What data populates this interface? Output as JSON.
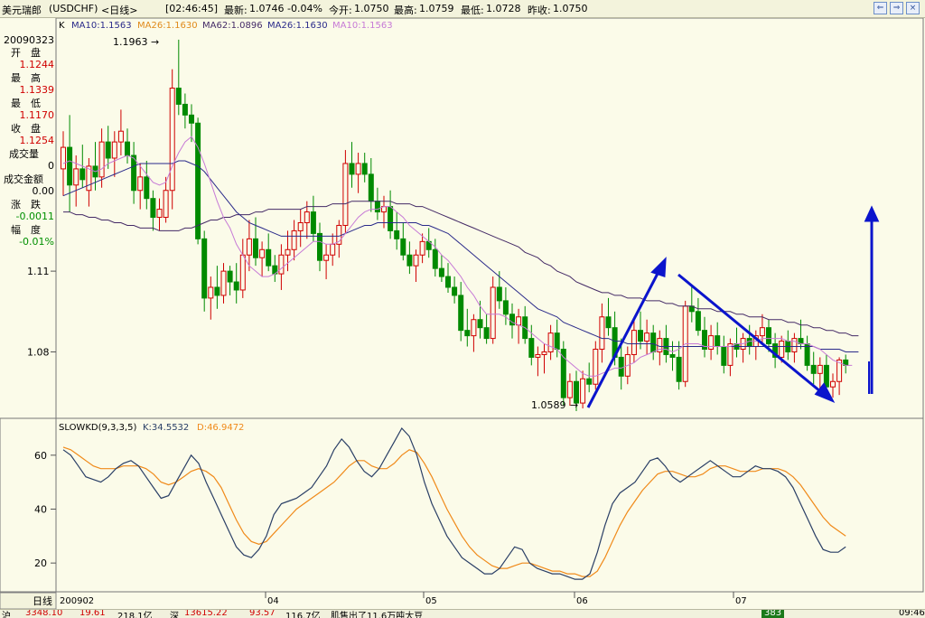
{
  "window": {
    "name": "美元瑞郎",
    "code": "(USDCHF)",
    "period": "<日线>",
    "time": "[02:46:45]",
    "latest_label": "最新:",
    "latest": "1.0746",
    "change": "-0.04%",
    "open_label": "今开:",
    "open": "1.0750",
    "high_label": "最高:",
    "high": "1.0759",
    "low_label": "最低:",
    "low": "1.0728",
    "prev_label": "昨收:",
    "prev": "1.0750"
  },
  "legend": {
    "k": "K",
    "ma": [
      "MA10:1.1563",
      "MA26:1.1630",
      "MA62:1.0896",
      "MA26:1.1630",
      "MA10:1.1563"
    ]
  },
  "info_panel": {
    "date": "20090323",
    "rows": [
      {
        "label": "开　盘",
        "value": "1.1244"
      },
      {
        "label": "最　高",
        "value": "1.1339"
      },
      {
        "label": "最　低",
        "value": "1.1170"
      },
      {
        "label": "收　盘",
        "value": "1.1254"
      },
      {
        "label": "成交量",
        "value": "0"
      },
      {
        "label": "成交金额",
        "value": "0.00"
      },
      {
        "label": "涨　跌",
        "value": "-0.0011"
      },
      {
        "label": "幅　度",
        "value": "-0.01%"
      }
    ]
  },
  "annotations": {
    "high_mark": "1.1963",
    "low_mark": "1.0589"
  },
  "kd_legend": {
    "name": "SLOWKD(9,3,3,5)",
    "k": "K:34.5532",
    "d": "D:46.9472"
  },
  "period_button": "日线",
  "colors": {
    "up": "#d00000",
    "down": "#008a00",
    "ma10": "#c77ad6",
    "ma26": "#2a2a8a",
    "ma62": "#442a66",
    "k_line": "#2a3f66",
    "d_line": "#f08a1a",
    "arrow": "#0b14cc",
    "bg": "#fbfbe9"
  },
  "status": {
    "sh_label": "沪",
    "sh_index": "3348.10",
    "sh_change": "19.61",
    "sh_amount": "218.1亿",
    "sz_label": "深",
    "sz_index": "13615.22",
    "sz_change": "93.57",
    "sz_amount": "116.7亿",
    "news": "肌售出了11.6万吨大豆",
    "badge": "383",
    "clock": "09:46"
  },
  "chart_data": {
    "type": "candlestick",
    "price_axis": {
      "ticks": [
        1.11,
        1.08
      ],
      "range": [
        1.057,
        1.2
      ]
    },
    "kd_axis": {
      "ticks": [
        60,
        40,
        20
      ],
      "range": [
        10,
        72
      ]
    },
    "time_labels": [
      "200902",
      "04",
      "05",
      "06",
      "07"
    ],
    "candles": [
      [
        1.148,
        1.162,
        1.138,
        1.156
      ],
      [
        1.156,
        1.168,
        1.132,
        1.142
      ],
      [
        1.142,
        1.153,
        1.134,
        1.148
      ],
      [
        1.148,
        1.157,
        1.141,
        1.144
      ],
      [
        1.14,
        1.152,
        1.134,
        1.149
      ],
      [
        1.149,
        1.158,
        1.14,
        1.145
      ],
      [
        1.145,
        1.163,
        1.141,
        1.158
      ],
      [
        1.158,
        1.164,
        1.148,
        1.152
      ],
      [
        1.152,
        1.162,
        1.145,
        1.158
      ],
      [
        1.158,
        1.17,
        1.153,
        1.162
      ],
      [
        1.158,
        1.163,
        1.15,
        1.153
      ],
      [
        1.153,
        1.158,
        1.135,
        1.14
      ],
      [
        1.14,
        1.15,
        1.133,
        1.145
      ],
      [
        1.145,
        1.151,
        1.133,
        1.137
      ],
      [
        1.137,
        1.14,
        1.125,
        1.13
      ],
      [
        1.13,
        1.137,
        1.125,
        1.133
      ],
      [
        1.13,
        1.145,
        1.128,
        1.14
      ],
      [
        1.14,
        1.185,
        1.133,
        1.178
      ],
      [
        1.178,
        1.196,
        1.168,
        1.172
      ],
      [
        1.172,
        1.176,
        1.163,
        1.168
      ],
      [
        1.168,
        1.172,
        1.158,
        1.165
      ],
      [
        1.165,
        1.167,
        1.12,
        1.122
      ],
      [
        1.122,
        1.125,
        1.095,
        1.1
      ],
      [
        1.1,
        1.108,
        1.092,
        1.104
      ],
      [
        1.104,
        1.112,
        1.096,
        1.101
      ],
      [
        1.101,
        1.113,
        1.098,
        1.11
      ],
      [
        1.11,
        1.112,
        1.101,
        1.106
      ],
      [
        1.106,
        1.113,
        1.098,
        1.103
      ],
      [
        1.103,
        1.122,
        1.1,
        1.116
      ],
      [
        1.116,
        1.129,
        1.11,
        1.122
      ],
      [
        1.122,
        1.13,
        1.112,
        1.115
      ],
      [
        1.115,
        1.121,
        1.108,
        1.118
      ],
      [
        1.118,
        1.124,
        1.11,
        1.112
      ],
      [
        1.112,
        1.116,
        1.106,
        1.109
      ],
      [
        1.109,
        1.12,
        1.103,
        1.116
      ],
      [
        1.116,
        1.125,
        1.11,
        1.118
      ],
      [
        1.118,
        1.129,
        1.114,
        1.125
      ],
      [
        1.125,
        1.133,
        1.119,
        1.128
      ],
      [
        1.128,
        1.136,
        1.122,
        1.132
      ],
      [
        1.132,
        1.138,
        1.121,
        1.124
      ],
      [
        1.124,
        1.128,
        1.11,
        1.114
      ],
      [
        1.114,
        1.12,
        1.107,
        1.116
      ],
      [
        1.116,
        1.124,
        1.112,
        1.12
      ],
      [
        1.12,
        1.129,
        1.115,
        1.127
      ],
      [
        1.127,
        1.155,
        1.124,
        1.15
      ],
      [
        1.15,
        1.158,
        1.141,
        1.146
      ],
      [
        1.146,
        1.154,
        1.139,
        1.15
      ],
      [
        1.15,
        1.154,
        1.143,
        1.146
      ],
      [
        1.146,
        1.152,
        1.132,
        1.136
      ],
      [
        1.136,
        1.141,
        1.129,
        1.132
      ],
      [
        1.132,
        1.138,
        1.126,
        1.134
      ],
      [
        1.134,
        1.14,
        1.122,
        1.125
      ],
      [
        1.125,
        1.132,
        1.118,
        1.122
      ],
      [
        1.122,
        1.128,
        1.114,
        1.116
      ],
      [
        1.116,
        1.121,
        1.109,
        1.112
      ],
      [
        1.112,
        1.118,
        1.106,
        1.116
      ],
      [
        1.116,
        1.124,
        1.113,
        1.121
      ],
      [
        1.121,
        1.126,
        1.115,
        1.118
      ],
      [
        1.118,
        1.122,
        1.108,
        1.111
      ],
      [
        1.111,
        1.116,
        1.106,
        1.108
      ],
      [
        1.108,
        1.113,
        1.102,
        1.104
      ],
      [
        1.104,
        1.108,
        1.098,
        1.101
      ],
      [
        1.101,
        1.106,
        1.084,
        1.088
      ],
      [
        1.088,
        1.096,
        1.082,
        1.086
      ],
      [
        1.086,
        1.094,
        1.08,
        1.092
      ],
      [
        1.092,
        1.099,
        1.085,
        1.089
      ],
      [
        1.089,
        1.094,
        1.083,
        1.085
      ],
      [
        1.085,
        1.108,
        1.083,
        1.104
      ],
      [
        1.104,
        1.11,
        1.096,
        1.099
      ],
      [
        1.099,
        1.104,
        1.09,
        1.094
      ],
      [
        1.094,
        1.098,
        1.085,
        1.09
      ],
      [
        1.09,
        1.096,
        1.083,
        1.093
      ],
      [
        1.093,
        1.097,
        1.083,
        1.085
      ],
      [
        1.085,
        1.09,
        1.075,
        1.078
      ],
      [
        1.078,
        1.082,
        1.071,
        1.079
      ],
      [
        1.079,
        1.083,
        1.072,
        1.08
      ],
      [
        1.08,
        1.09,
        1.077,
        1.087
      ],
      [
        1.087,
        1.092,
        1.078,
        1.081
      ],
      [
        1.081,
        1.084,
        1.06,
        1.063
      ],
      [
        1.063,
        1.072,
        1.06,
        1.069
      ],
      [
        1.069,
        1.073,
        1.058,
        1.061
      ],
      [
        1.061,
        1.073,
        1.059,
        1.07
      ],
      [
        1.07,
        1.076,
        1.065,
        1.068
      ],
      [
        1.068,
        1.084,
        1.066,
        1.081
      ],
      [
        1.081,
        1.098,
        1.076,
        1.093
      ],
      [
        1.093,
        1.1,
        1.086,
        1.089
      ],
      [
        1.089,
        1.095,
        1.075,
        1.078
      ],
      [
        1.078,
        1.085,
        1.066,
        1.071
      ],
      [
        1.071,
        1.082,
        1.068,
        1.079
      ],
      [
        1.079,
        1.092,
        1.076,
        1.088
      ],
      [
        1.088,
        1.095,
        1.081,
        1.084
      ],
      [
        1.084,
        1.092,
        1.079,
        1.087
      ],
      [
        1.087,
        1.09,
        1.077,
        1.08
      ],
      [
        1.08,
        1.088,
        1.075,
        1.085
      ],
      [
        1.085,
        1.09,
        1.076,
        1.079
      ],
      [
        1.079,
        1.084,
        1.073,
        1.078
      ],
      [
        1.078,
        1.084,
        1.066,
        1.069
      ],
      [
        1.069,
        1.099,
        1.067,
        1.097
      ],
      [
        1.097,
        1.105,
        1.091,
        1.095
      ],
      [
        1.095,
        1.1,
        1.086,
        1.088
      ],
      [
        1.088,
        1.093,
        1.078,
        1.081
      ],
      [
        1.081,
        1.09,
        1.077,
        1.086
      ],
      [
        1.086,
        1.091,
        1.079,
        1.082
      ],
      [
        1.082,
        1.086,
        1.072,
        1.075
      ],
      [
        1.075,
        1.085,
        1.071,
        1.083
      ],
      [
        1.083,
        1.089,
        1.078,
        1.081
      ],
      [
        1.081,
        1.087,
        1.076,
        1.085
      ],
      [
        1.085,
        1.09,
        1.079,
        1.082
      ],
      [
        1.082,
        1.088,
        1.077,
        1.086
      ],
      [
        1.086,
        1.094,
        1.083,
        1.089
      ],
      [
        1.089,
        1.092,
        1.08,
        1.083
      ],
      [
        1.083,
        1.087,
        1.074,
        1.078
      ],
      [
        1.078,
        1.086,
        1.076,
        1.084
      ],
      [
        1.084,
        1.088,
        1.077,
        1.08
      ],
      [
        1.08,
        1.087,
        1.076,
        1.085
      ],
      [
        1.085,
        1.092,
        1.081,
        1.083
      ],
      [
        1.083,
        1.086,
        1.073,
        1.075
      ],
      [
        1.075,
        1.08,
        1.068,
        1.072
      ],
      [
        1.072,
        1.078,
        1.066,
        1.075
      ],
      [
        1.075,
        1.079,
        1.065,
        1.067
      ],
      [
        1.067,
        1.072,
        1.063,
        1.069
      ],
      [
        1.069,
        1.078,
        1.064,
        1.077
      ],
      [
        1.077,
        1.079,
        1.072,
        1.075
      ]
    ],
    "ma10": [
      1.15,
      1.151,
      1.15,
      1.149,
      1.148,
      1.147,
      1.148,
      1.15,
      1.151,
      1.152,
      1.153,
      1.152,
      1.149,
      1.146,
      1.143,
      1.142,
      1.143,
      1.149,
      1.154,
      1.158,
      1.16,
      1.156,
      1.15,
      1.143,
      1.136,
      1.13,
      1.126,
      1.12,
      1.116,
      1.112,
      1.11,
      1.108,
      1.108,
      1.109,
      1.111,
      1.113,
      1.115,
      1.117,
      1.119,
      1.121,
      1.121,
      1.12,
      1.12,
      1.121,
      1.124,
      1.127,
      1.13,
      1.132,
      1.133,
      1.133,
      1.134,
      1.134,
      1.132,
      1.13,
      1.127,
      1.125,
      1.123,
      1.121,
      1.119,
      1.116,
      1.114,
      1.111,
      1.108,
      1.104,
      1.101,
      1.097,
      1.094,
      1.094,
      1.094,
      1.093,
      1.091,
      1.09,
      1.089,
      1.087,
      1.085,
      1.083,
      1.082,
      1.081,
      1.078,
      1.076,
      1.074,
      1.072,
      1.071,
      1.071,
      1.072,
      1.073,
      1.074,
      1.074,
      1.075,
      1.076,
      1.078,
      1.079,
      1.08,
      1.081,
      1.081,
      1.08,
      1.081,
      1.083,
      1.083,
      1.083,
      1.082,
      1.082,
      1.082,
      1.082,
      1.082,
      1.083,
      1.083,
      1.084,
      1.084,
      1.085,
      1.085,
      1.085,
      1.085,
      1.084,
      1.084,
      1.083,
      1.083,
      1.082,
      1.081,
      1.079,
      1.077,
      1.076,
      1.075,
      1.075
    ],
    "ma26": [
      1.138,
      1.139,
      1.14,
      1.141,
      1.142,
      1.143,
      1.144,
      1.145,
      1.146,
      1.147,
      1.148,
      1.149,
      1.15,
      1.15,
      1.15,
      1.15,
      1.15,
      1.15,
      1.151,
      1.151,
      1.15,
      1.149,
      1.147,
      1.144,
      1.141,
      1.138,
      1.135,
      1.132,
      1.13,
      1.128,
      1.127,
      1.126,
      1.125,
      1.124,
      1.123,
      1.123,
      1.123,
      1.123,
      1.123,
      1.123,
      1.123,
      1.123,
      1.123,
      1.123,
      1.124,
      1.125,
      1.126,
      1.127,
      1.127,
      1.128,
      1.128,
      1.128,
      1.128,
      1.128,
      1.128,
      1.128,
      1.127,
      1.127,
      1.126,
      1.125,
      1.124,
      1.122,
      1.12,
      1.118,
      1.116,
      1.114,
      1.112,
      1.11,
      1.108,
      1.106,
      1.104,
      1.102,
      1.1,
      1.098,
      1.096,
      1.095,
      1.094,
      1.093,
      1.091,
      1.09,
      1.089,
      1.088,
      1.087,
      1.086,
      1.085,
      1.085,
      1.084,
      1.084,
      1.083,
      1.083,
      1.083,
      1.083,
      1.083,
      1.082,
      1.082,
      1.082,
      1.082,
      1.082,
      1.082,
      1.082,
      1.082,
      1.082,
      1.082,
      1.082,
      1.082,
      1.082,
      1.082,
      1.082,
      1.082,
      1.082,
      1.082,
      1.082,
      1.082,
      1.082,
      1.082,
      1.082,
      1.082,
      1.082,
      1.081,
      1.081,
      1.081,
      1.081,
      1.08,
      1.08,
      1.08
    ],
    "ma62": [
      1.132,
      1.132,
      1.131,
      1.131,
      1.13,
      1.13,
      1.129,
      1.129,
      1.128,
      1.128,
      1.127,
      1.127,
      1.126,
      1.126,
      1.126,
      1.125,
      1.125,
      1.125,
      1.125,
      1.126,
      1.126,
      1.127,
      1.128,
      1.129,
      1.129,
      1.13,
      1.13,
      1.131,
      1.131,
      1.131,
      1.132,
      1.132,
      1.133,
      1.133,
      1.133,
      1.133,
      1.133,
      1.133,
      1.134,
      1.134,
      1.134,
      1.134,
      1.135,
      1.135,
      1.135,
      1.136,
      1.136,
      1.136,
      1.136,
      1.136,
      1.136,
      1.136,
      1.135,
      1.135,
      1.135,
      1.134,
      1.134,
      1.133,
      1.132,
      1.131,
      1.13,
      1.129,
      1.128,
      1.127,
      1.126,
      1.125,
      1.124,
      1.123,
      1.122,
      1.121,
      1.12,
      1.119,
      1.117,
      1.116,
      1.115,
      1.113,
      1.112,
      1.11,
      1.109,
      1.108,
      1.106,
      1.105,
      1.104,
      1.103,
      1.102,
      1.102,
      1.101,
      1.101,
      1.1,
      1.1,
      1.1,
      1.099,
      1.099,
      1.099,
      1.098,
      1.098,
      1.097,
      1.097,
      1.097,
      1.096,
      1.096,
      1.096,
      1.095,
      1.095,
      1.095,
      1.094,
      1.094,
      1.093,
      1.093,
      1.093,
      1.092,
      1.092,
      1.092,
      1.091,
      1.091,
      1.09,
      1.09,
      1.089,
      1.089,
      1.088,
      1.088,
      1.087,
      1.087,
      1.086,
      1.086
    ],
    "slow_k": [
      62,
      60,
      56,
      52,
      51,
      50,
      52,
      55,
      57,
      58,
      56,
      52,
      48,
      44,
      45,
      50,
      55,
      60,
      57,
      50,
      44,
      38,
      32,
      26,
      23,
      22,
      25,
      30,
      38,
      42,
      43,
      44,
      46,
      48,
      52,
      56,
      62,
      66,
      63,
      58,
      54,
      52,
      55,
      60,
      65,
      70,
      67,
      60,
      50,
      42,
      36,
      30,
      26,
      22,
      20,
      18,
      16,
      16,
      18,
      22,
      26,
      25,
      20,
      18,
      17,
      16,
      16,
      15,
      14,
      14,
      16,
      24,
      34,
      42,
      46,
      48,
      50,
      54,
      58,
      59,
      56,
      52,
      50,
      52,
      54,
      56,
      58,
      56,
      54,
      52,
      52,
      54,
      56,
      55,
      55,
      54,
      52,
      48,
      42,
      36,
      30,
      25,
      24,
      24,
      26
    ],
    "slow_d": [
      63,
      62,
      60,
      58,
      56,
      55,
      55,
      55,
      56,
      56,
      56,
      55,
      53,
      50,
      49,
      50,
      52,
      54,
      55,
      54,
      52,
      48,
      42,
      36,
      31,
      28,
      27,
      28,
      31,
      34,
      37,
      40,
      42,
      44,
      46,
      48,
      50,
      53,
      56,
      58,
      58,
      56,
      55,
      55,
      57,
      60,
      62,
      61,
      57,
      52,
      46,
      40,
      35,
      30,
      26,
      23,
      21,
      19,
      18,
      18,
      19,
      20,
      20,
      19,
      18,
      17,
      17,
      16,
      16,
      15,
      15,
      17,
      22,
      28,
      34,
      39,
      43,
      47,
      50,
      53,
      54,
      54,
      53,
      52,
      52,
      53,
      55,
      56,
      56,
      55,
      54,
      54,
      54,
      55,
      55,
      55,
      54,
      52,
      49,
      45,
      41,
      37,
      34,
      32,
      30
    ]
  }
}
